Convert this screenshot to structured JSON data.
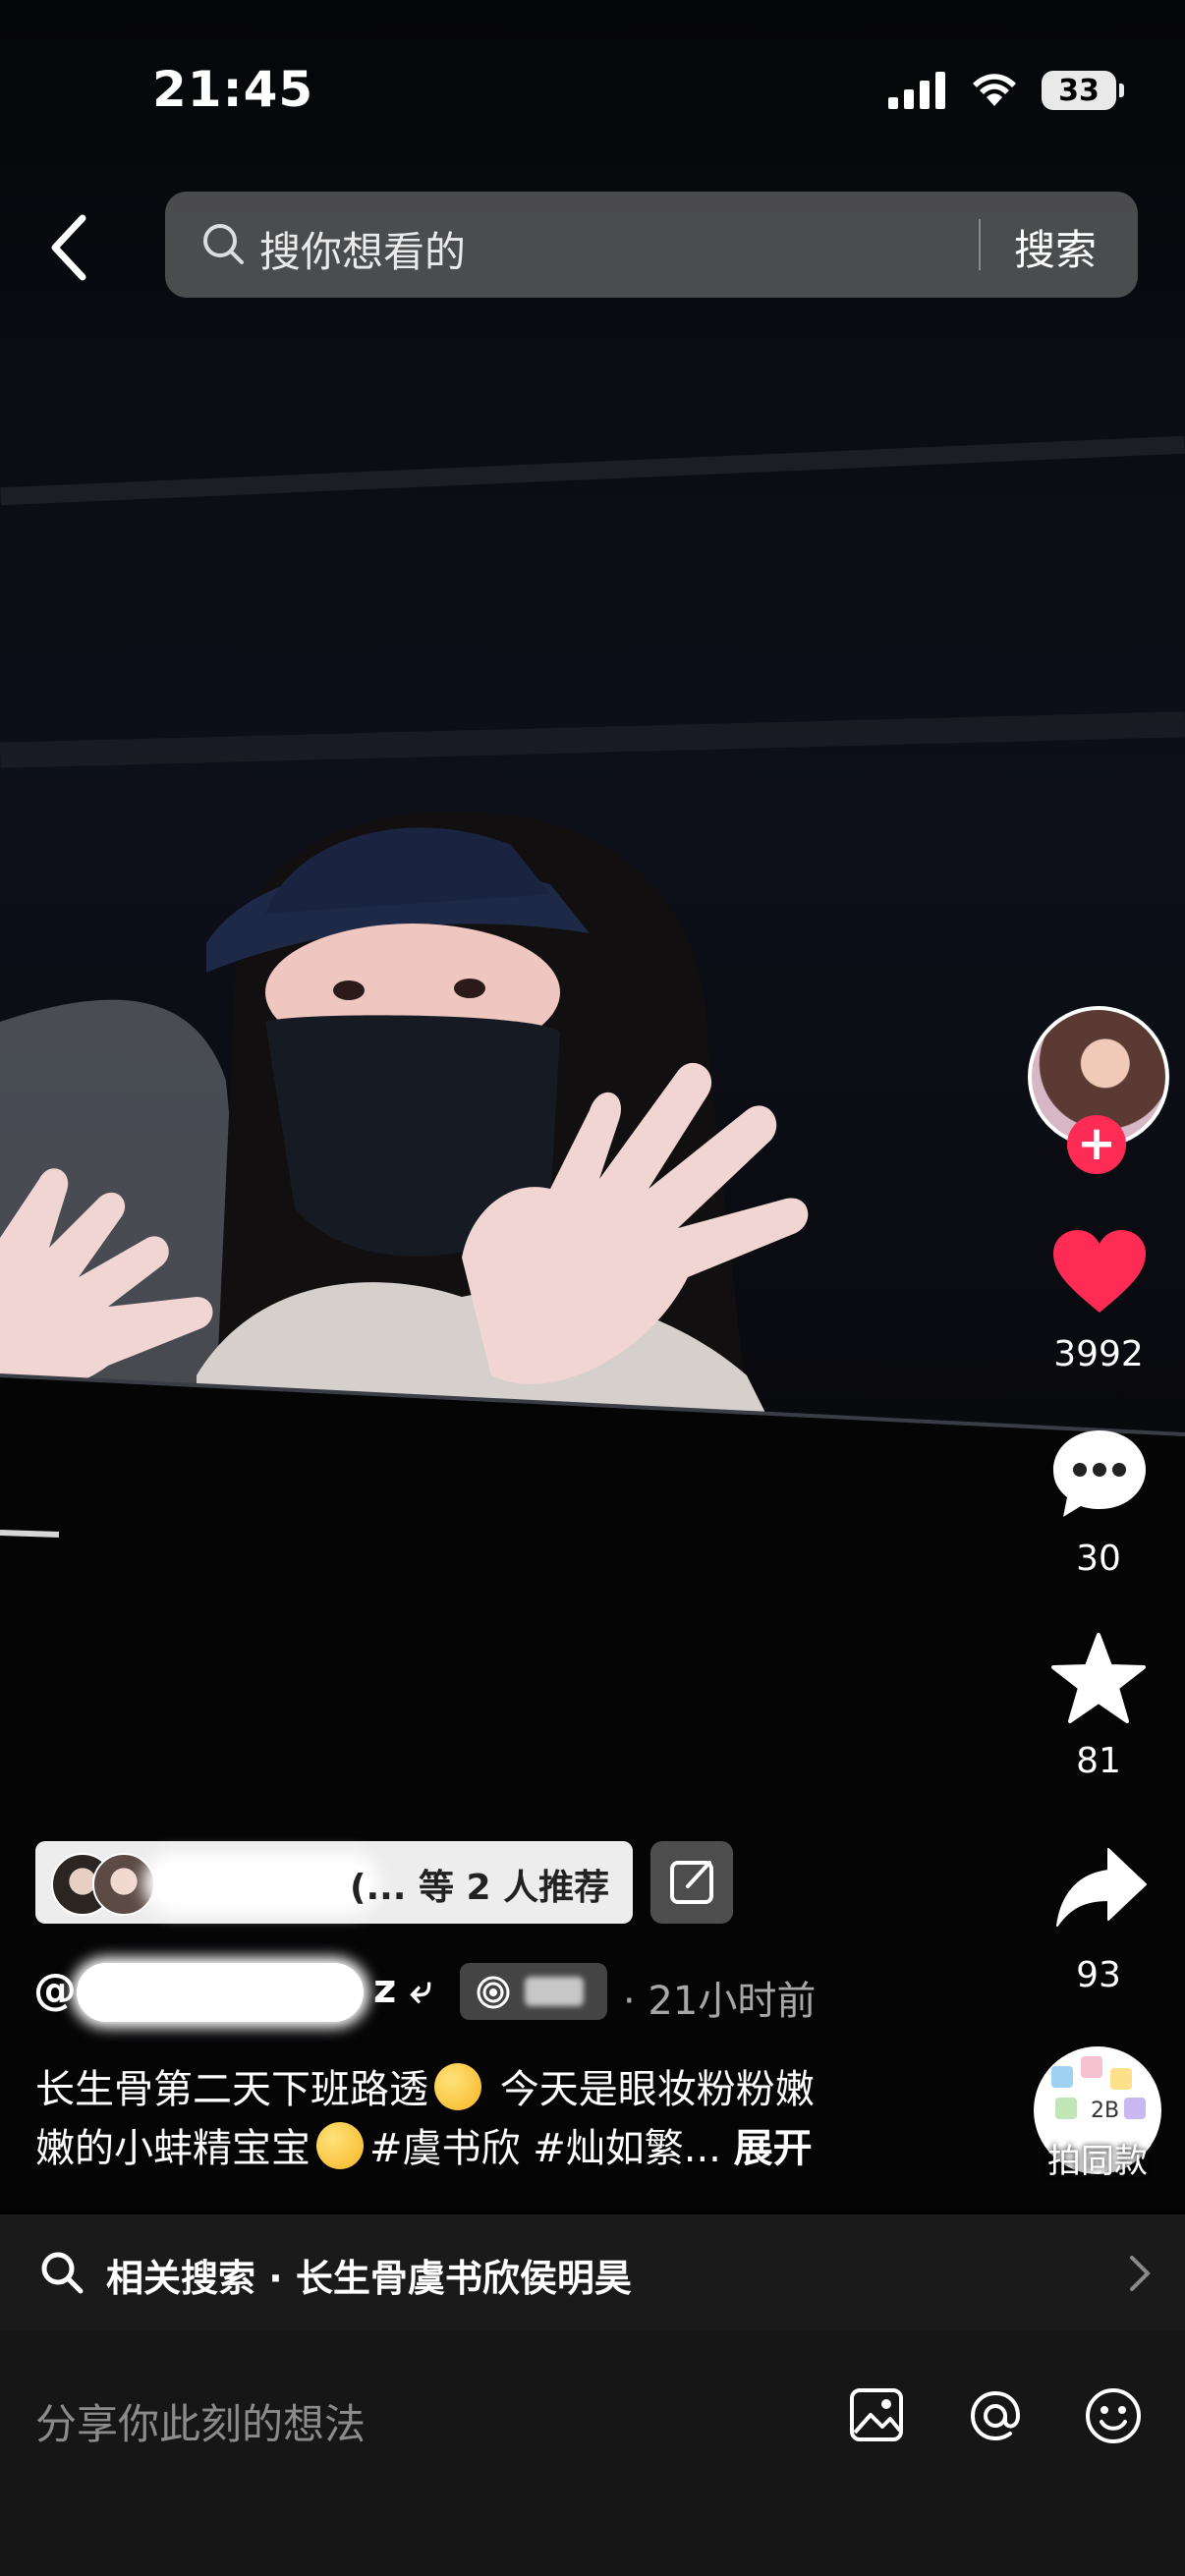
{
  "status_bar": {
    "time": "21:45",
    "battery": "33"
  },
  "search": {
    "placeholder": "搜你想看的",
    "button": "搜索"
  },
  "rail": {
    "like_count": "3992",
    "comment_count": "30",
    "favorite_count": "81",
    "share_count": "93",
    "remix_label": "拍同款"
  },
  "recommend": {
    "text": "(... 等 2 人推荐"
  },
  "author": {
    "at": "@",
    "tail": "z ⤶",
    "badge": "◎",
    "time_ago": "· 21小时前"
  },
  "caption": {
    "line1_a": "长生骨第二天下班路透",
    "line1_b": " 今天是眼妆粉粉嫩",
    "line2_a": "嫩的小蚌精宝宝",
    "line2_b": "#虞书欣 #灿如繁...",
    "expand": "展开"
  },
  "related_search": {
    "label": "相关搜索 · 长生骨虞书欣侯明昊"
  },
  "comment_bar": {
    "placeholder": "分享你此刻的想法"
  },
  "colors": {
    "like": "#fe2c55",
    "follow": "#fe2c55"
  }
}
